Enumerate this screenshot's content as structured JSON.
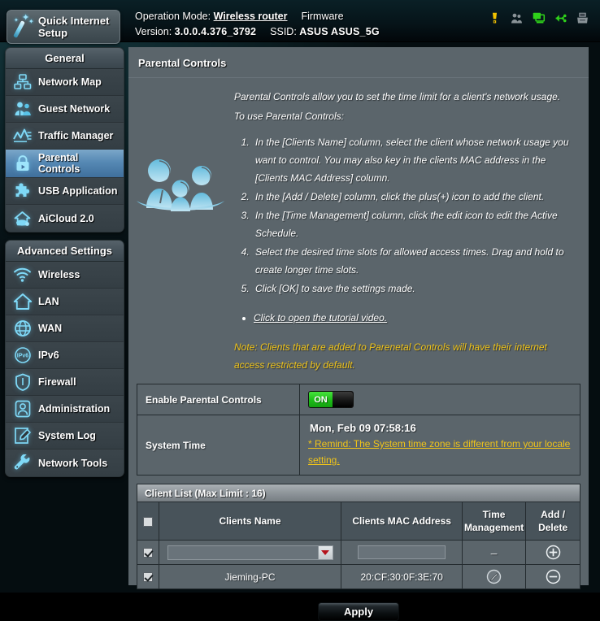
{
  "header": {
    "quick_setup_label": "Quick Internet Setup",
    "operation_mode_label": "Operation Mode:",
    "operation_mode_value": "Wireless router",
    "firmware_label": "Firmware",
    "firmware_version_label": "Version:",
    "firmware_version_value": "3.0.0.4.376_3792",
    "ssid_label": "SSID:",
    "ssid_value": "ASUS ASUS_5G",
    "icons": [
      {
        "name": "notification-icon",
        "color": "#f2c200"
      },
      {
        "name": "guest-network-users-icon",
        "color": "#8a9398"
      },
      {
        "name": "monitor-clients-icon",
        "color": "#2fd11a"
      },
      {
        "name": "usb-icon",
        "color": "#2fd11a"
      },
      {
        "name": "printer-icon",
        "color": "#8a9398"
      }
    ]
  },
  "sidebar": {
    "groups": [
      {
        "title": "General",
        "items": [
          {
            "label": "Network Map",
            "icon": "network-map-icon",
            "active": false
          },
          {
            "label": "Guest Network",
            "icon": "guest-network-icon",
            "active": false
          },
          {
            "label": "Traffic Manager",
            "icon": "traffic-manager-icon",
            "active": false
          },
          {
            "label": "Parental Controls",
            "icon": "parental-controls-lock-icon",
            "active": true
          },
          {
            "label": "USB Application",
            "icon": "usb-application-puzzle-icon",
            "active": false
          },
          {
            "label": "AiCloud 2.0",
            "icon": "aicloud-icon",
            "active": false
          }
        ]
      },
      {
        "title": "Advanced Settings",
        "items": [
          {
            "label": "Wireless",
            "icon": "wireless-signal-icon",
            "active": false
          },
          {
            "label": "LAN",
            "icon": "lan-home-icon",
            "active": false
          },
          {
            "label": "WAN",
            "icon": "wan-globe-icon",
            "active": false
          },
          {
            "label": "IPv6",
            "icon": "ipv6-icon",
            "active": false
          },
          {
            "label": "Firewall",
            "icon": "firewall-shield-icon",
            "active": false
          },
          {
            "label": "Administration",
            "icon": "administration-user-icon",
            "active": false
          },
          {
            "label": "System Log",
            "icon": "system-log-icon",
            "active": false
          },
          {
            "label": "Network Tools",
            "icon": "network-tools-wrench-icon",
            "active": false
          }
        ]
      }
    ]
  },
  "main": {
    "page_title": "Parental Controls",
    "intro_line_1": "Parental Controls allow you to set the time limit for a client's network usage.",
    "intro_line_2": "To use Parental Controls:",
    "steps": [
      "In the [Clients Name] column, select the client whose network usage you want to control. You may also key in the clients MAC address in the [Clients MAC Address] column.",
      "In the [Add / Delete] column, click the plus(+) icon to add the client.",
      "In the [Time Management] column, click the edit icon to edit the Active Schedule.",
      "Select the desired time slots for allowed access times. Drag and hold to create longer time slots.",
      "Click [OK] to save the settings made."
    ],
    "tutorial_link": "Click to open the tutorial video.",
    "note": "Note: Clients that are added to Parenetal Controls will have their internet access restricted by default.",
    "note_color": "#f0c419"
  },
  "settings": {
    "enable_label": "Enable Parental Controls",
    "enable_state": "ON",
    "system_time_label": "System Time",
    "system_time_value": "Mon, Feb 09  07:58:16",
    "system_time_remind": "* Remind: The System time zone is different from your locale setting."
  },
  "client_list": {
    "title": "Client List (Max Limit : 16)",
    "columns": [
      "",
      "Clients Name",
      "Clients MAC Address",
      "Time Management",
      "Add / Delete"
    ],
    "header_checkbox_checked": false,
    "rows": [
      {
        "checked": true,
        "type": "input",
        "name_value": "",
        "mac_value": "",
        "time_management": "–",
        "action_icon": "add-circle-icon"
      },
      {
        "checked": true,
        "type": "entry",
        "name_value": "Jieming-PC",
        "mac_value": "20:CF:30:0F:3E:70",
        "time_management": "edit-pencil-icon",
        "action_icon": "remove-circle-icon"
      }
    ]
  },
  "footer": {
    "apply_label": "Apply"
  }
}
